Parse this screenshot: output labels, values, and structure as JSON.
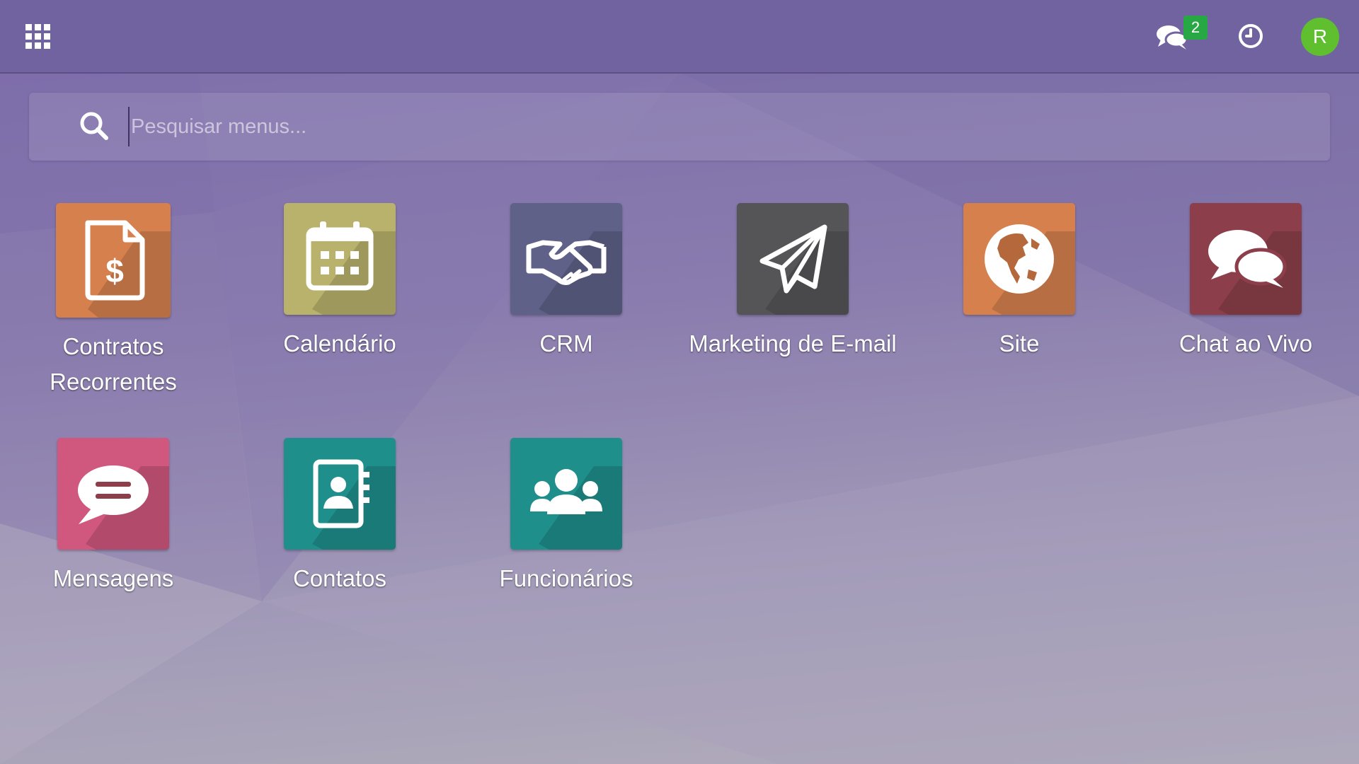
{
  "topbar": {
    "apps_menu_icon": "grid-icon",
    "chat_icon": "comments-icon",
    "chat_badge_count": "2",
    "activity_icon": "clock-icon",
    "user_initial": "R",
    "avatar_color": "#5fbf2f"
  },
  "search": {
    "placeholder": "Pesquisar menus...",
    "icon": "search-icon"
  },
  "apps": [
    {
      "label": "Contratos Recorrentes",
      "icon": "invoice-dollar-icon",
      "color": "#d5804d"
    },
    {
      "label": "Calendário",
      "icon": "calendar-icon",
      "color": "#b9b26c"
    },
    {
      "label": "CRM",
      "icon": "handshake-icon",
      "color": "#5f6189"
    },
    {
      "label": "Marketing de E-mail",
      "icon": "paper-plane-icon",
      "color": "#555558"
    },
    {
      "label": "Site",
      "icon": "globe-icon",
      "color": "#d5804d"
    },
    {
      "label": "Chat ao Vivo",
      "icon": "chat-bubbles-icon",
      "color": "#8c3f4a"
    },
    {
      "label": "Mensagens",
      "icon": "message-bubble-icon",
      "color": "#d0577e"
    },
    {
      "label": "Contatos",
      "icon": "address-book-icon",
      "color": "#1f8f8c"
    },
    {
      "label": "Funcionários",
      "icon": "people-group-icon",
      "color": "#1f8f8c"
    }
  ]
}
